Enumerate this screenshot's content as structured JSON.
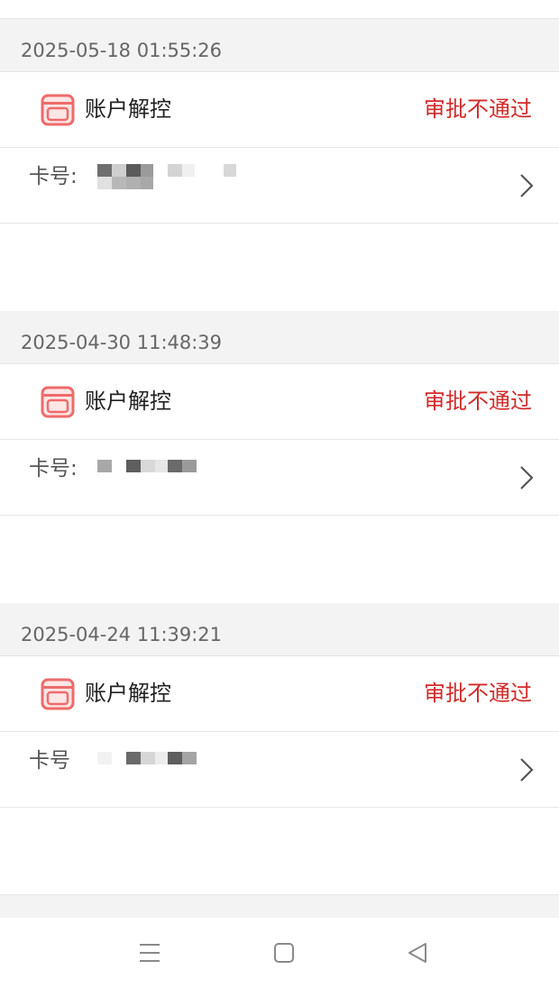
{
  "records": [
    {
      "datetime": "2025-05-18 01:55:26",
      "type": "账户解控",
      "status": "审批不通过",
      "card_label": "卡号:",
      "icon": "card-icon",
      "chevron": "chevron-right-icon"
    },
    {
      "datetime": "2025-04-30 11:48:39",
      "type": "账户解控",
      "status": "审批不通过",
      "card_label": "卡号:",
      "icon": "card-icon",
      "chevron": "chevron-right-icon"
    },
    {
      "datetime": "2025-04-24 11:39:21",
      "type": "账户解控",
      "status": "审批不通过",
      "card_label": "卡号",
      "icon": "card-icon",
      "chevron": "chevron-right-icon"
    }
  ],
  "nav": {
    "menu": "menu-icon",
    "home": "home-icon",
    "back": "back-icon"
  },
  "colors": {
    "status": "#d22a2a",
    "icon": "#ee6b6b",
    "header_bg": "#f3f3f3"
  }
}
